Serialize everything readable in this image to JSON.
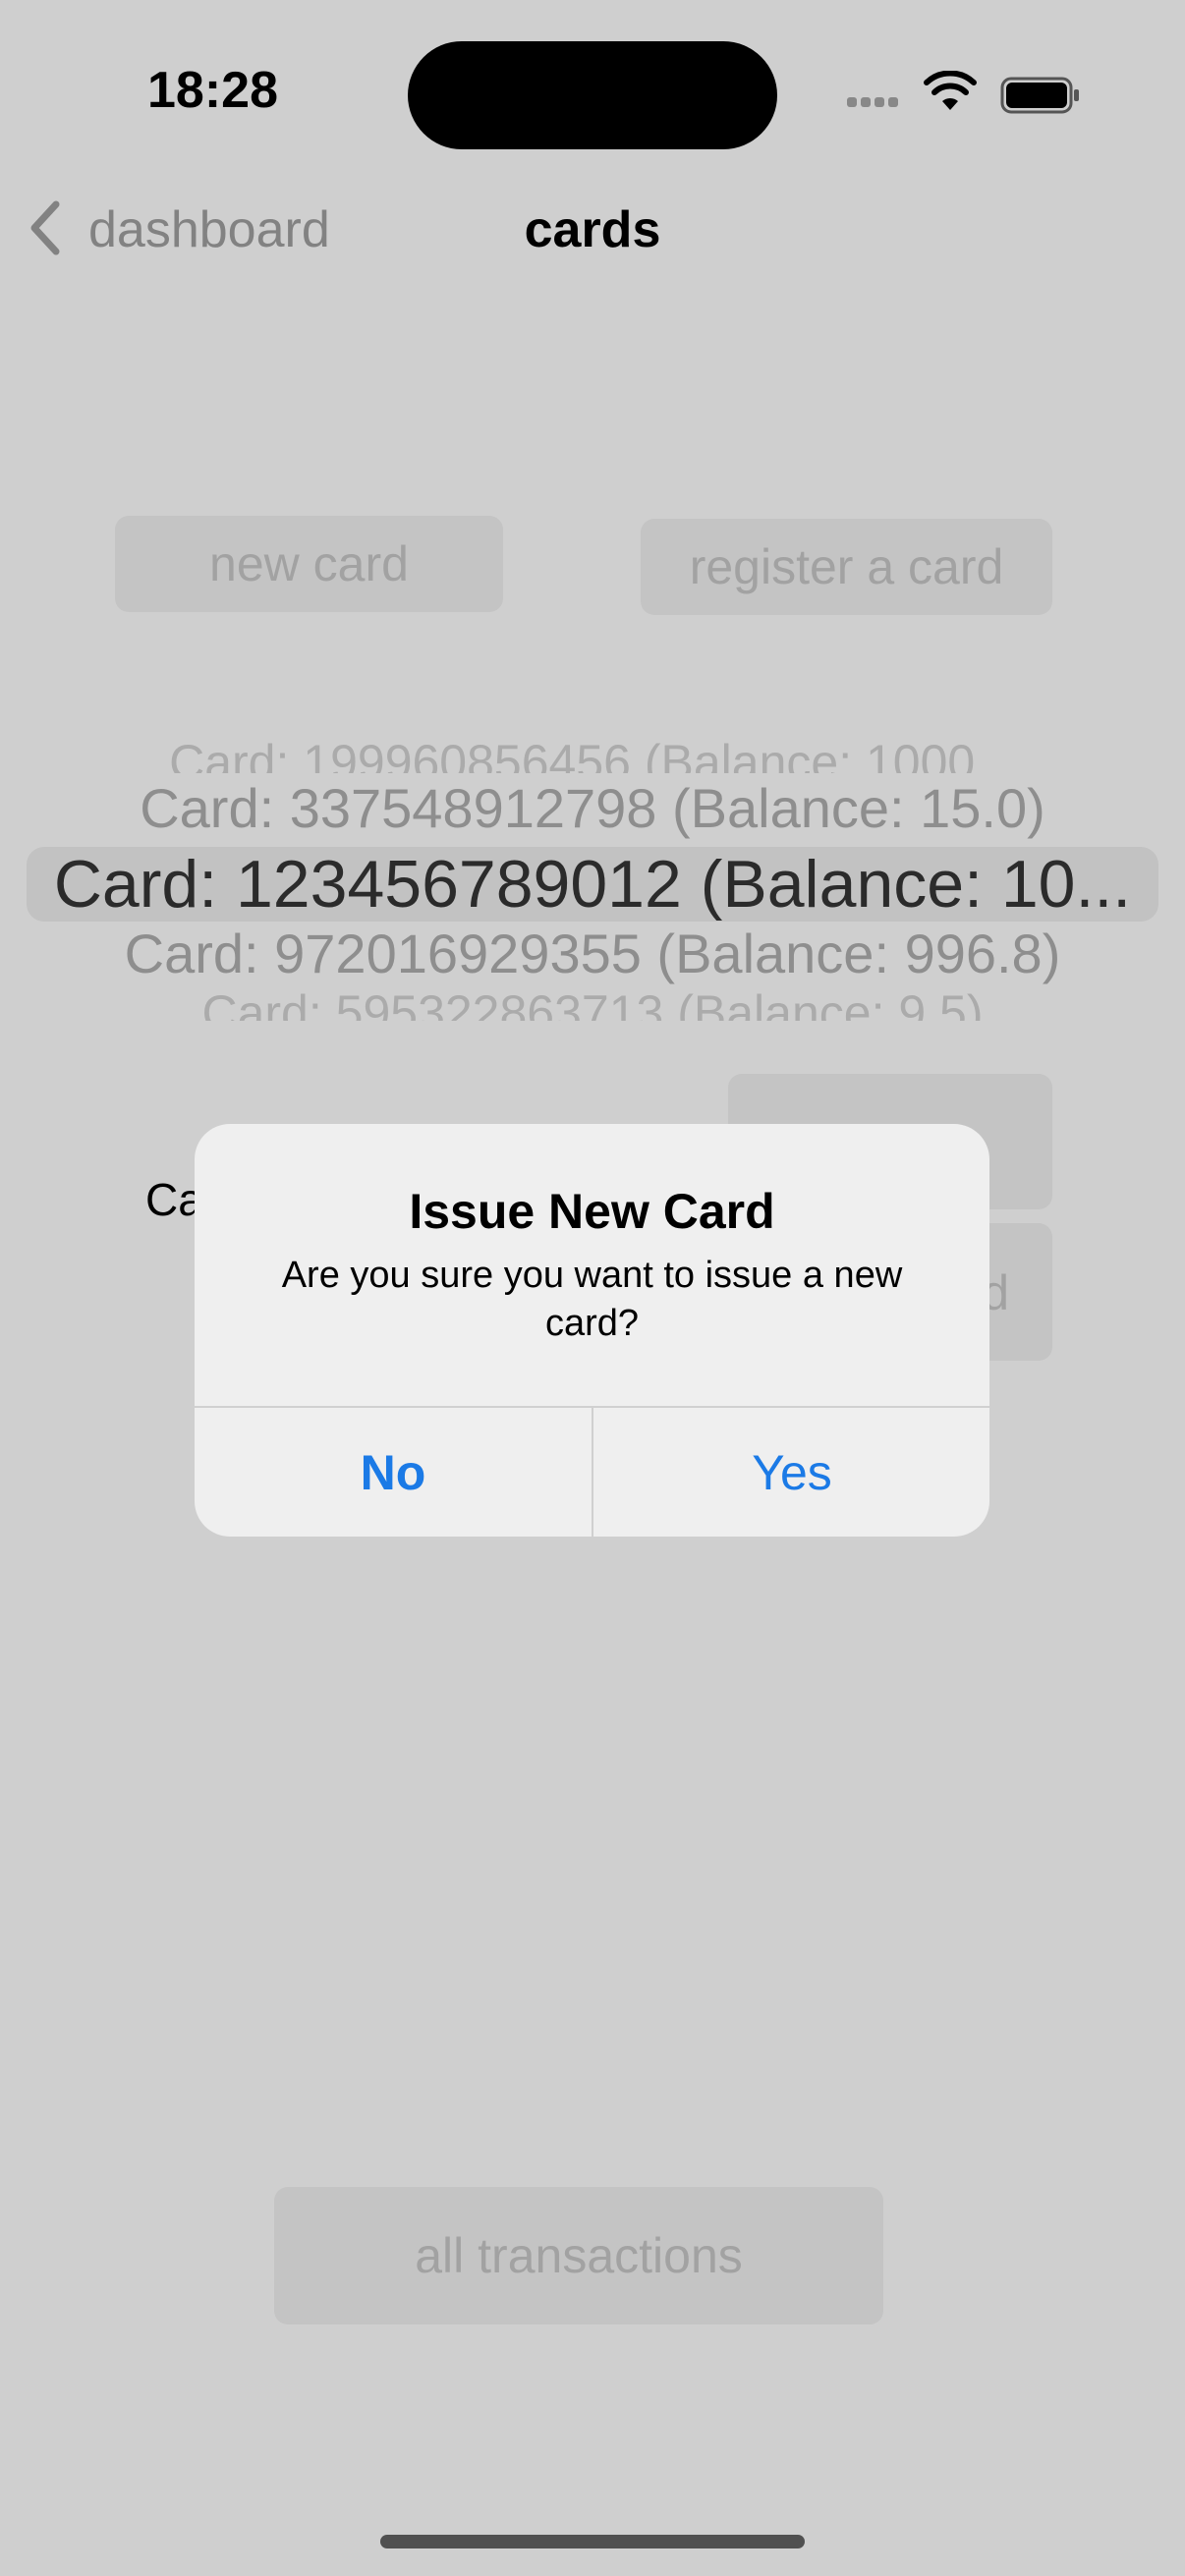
{
  "status_bar": {
    "time": "18:28",
    "icons": [
      "signal-dots-icon",
      "wifi-icon",
      "battery-icon"
    ]
  },
  "nav": {
    "back_label": "dashboard",
    "title": "cards"
  },
  "actions": {
    "new_card": "new card",
    "register_card": "register a card"
  },
  "picker": {
    "rows": [
      "Card: 199960856456 (Balance: 1000...",
      "Card: 337548912798 (Balance: 15.0)",
      "Card: 123456789012 (Balance: 10...",
      "Card: 972016929355 (Balance: 996.8)",
      "Card: 595322863713 (Balance: 9.5)"
    ],
    "selected_index": 2
  },
  "background": {
    "partial_label": "Ca",
    "partial_button_text": "d"
  },
  "dialog": {
    "title": "Issue New Card",
    "message": "Are you sure you want to issue a new card?",
    "no": "No",
    "yes": "Yes"
  },
  "footer": {
    "all_transactions": "all transactions"
  },
  "colors": {
    "accent": "#1b7ae6",
    "dimmed_background": "#cfcfcf"
  }
}
